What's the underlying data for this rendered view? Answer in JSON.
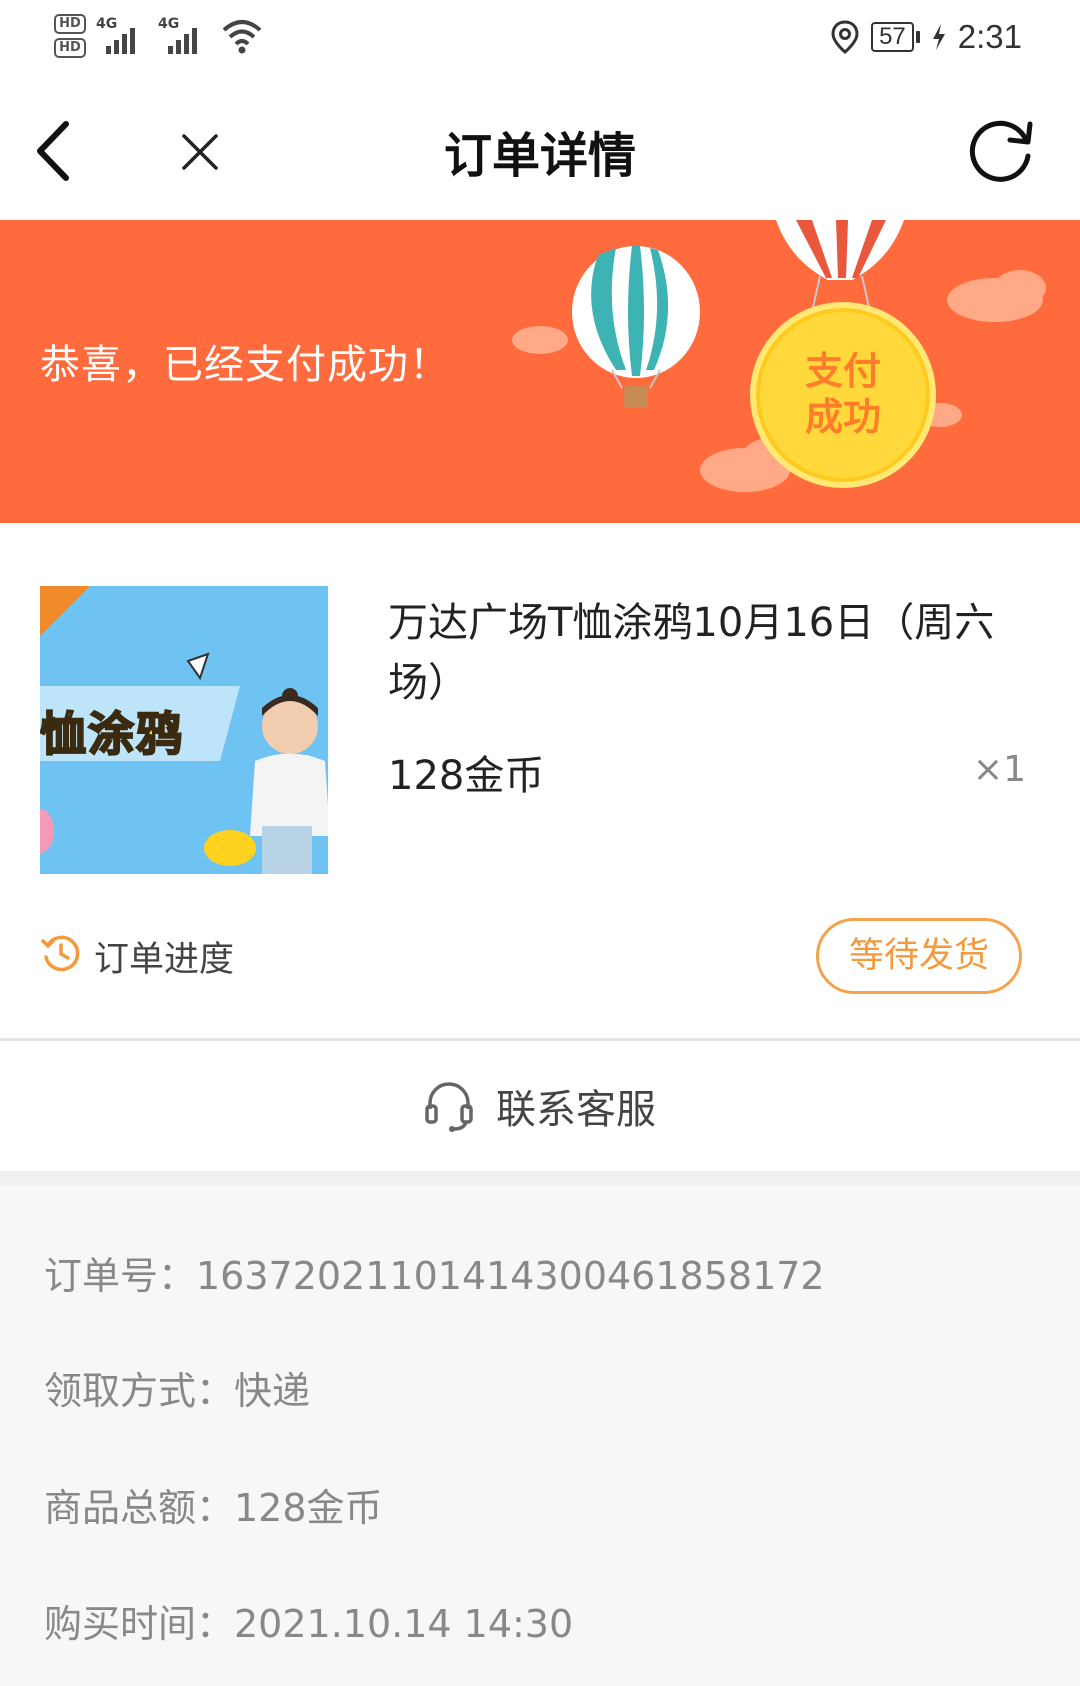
{
  "status_bar": {
    "sim1": "HD",
    "sim2": "HD",
    "net1": "4G",
    "net2": "4G",
    "battery": "57",
    "time": "2:31"
  },
  "nav": {
    "title": "订单详情"
  },
  "banner": {
    "message": "恭喜，已经支付成功！",
    "seal_line1": "支付",
    "seal_line2": "成功",
    "colors": {
      "background": "#ff6b3d",
      "seal": "#ffd93b",
      "seal_text": "#ff7d2a"
    }
  },
  "product": {
    "thumb_text": "恤涂鸦",
    "name": "万达广场T恤涂鸦10月16日（周六场）",
    "price": "128金币",
    "quantity": "×1",
    "progress_label": "订单进度",
    "status_button": "等待发货"
  },
  "contact": {
    "label": "联系客服"
  },
  "details": {
    "order_no": "订单号：163720211014143004618581​72",
    "pickup": "领取方式：快递",
    "total": "商品总额：128金币",
    "purchase_time": "购买时间：2021.10.14 14:30"
  },
  "accent_color": "#f39a3e"
}
